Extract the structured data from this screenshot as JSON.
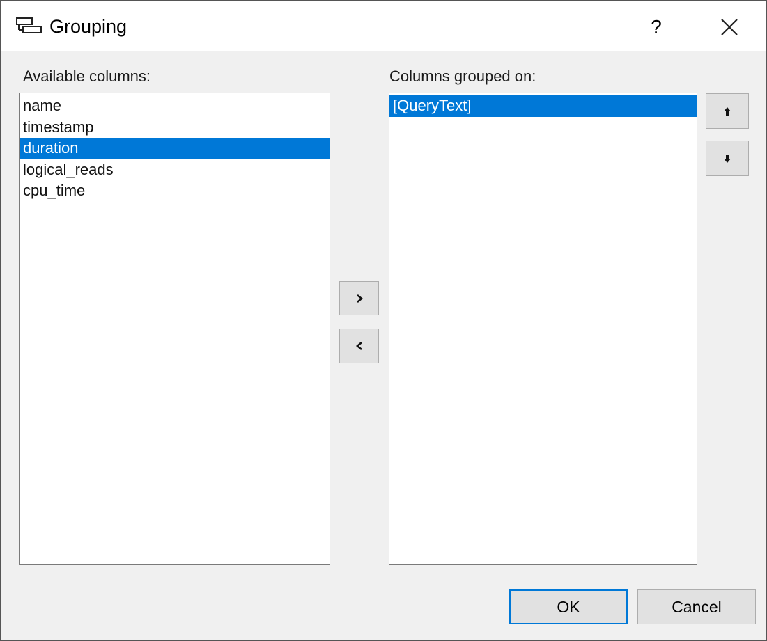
{
  "dialog": {
    "title": "Grouping",
    "help_label": "?",
    "icon": "grouping-icon"
  },
  "available": {
    "label": "Available columns:",
    "items": [
      {
        "label": "name",
        "selected": false
      },
      {
        "label": "timestamp",
        "selected": false
      },
      {
        "label": "duration",
        "selected": true
      },
      {
        "label": "logical_reads",
        "selected": false
      },
      {
        "label": "cpu_time",
        "selected": false
      }
    ]
  },
  "grouped": {
    "label": "Columns grouped on:",
    "items": [
      {
        "label": "[QueryText]",
        "selected": true
      }
    ]
  },
  "buttons": {
    "add": "›",
    "remove": "‹",
    "move_up": "↑",
    "move_down": "↓",
    "ok": "OK",
    "cancel": "Cancel"
  },
  "colors": {
    "selection": "#0078d7",
    "dialog_bg": "#f0f0f0",
    "button_bg": "#e1e1e1"
  }
}
